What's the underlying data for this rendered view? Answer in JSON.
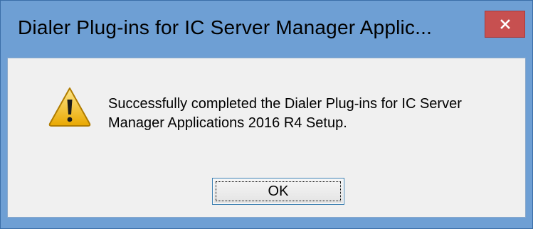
{
  "dialog": {
    "title": "Dialer Plug-ins for IC Server Manager Applic...",
    "close_icon": "close-icon",
    "warning_icon": "warning-icon",
    "message": "Successfully completed the Dialer Plug-ins for IC Server Manager Applications 2016 R4 Setup.",
    "ok_label": "OK"
  },
  "colors": {
    "titlebar": "#6e9fd4",
    "close_button": "#c75050",
    "client_background": "#f0f0f0",
    "warning_yellow": "#f5c518"
  }
}
